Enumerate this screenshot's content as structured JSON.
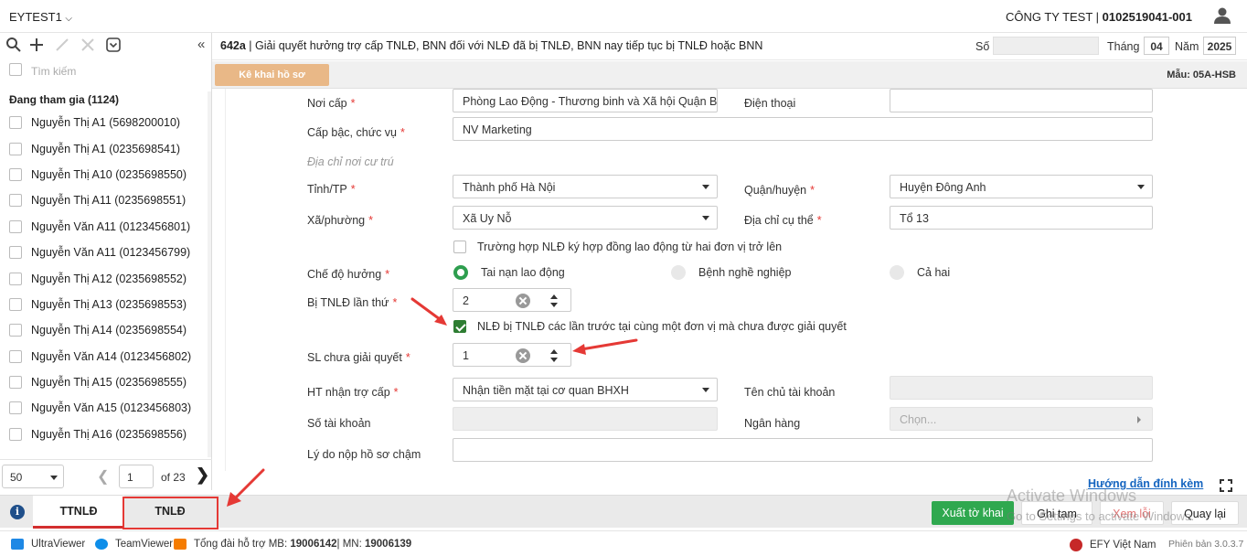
{
  "app": {
    "title": "EYTEST1",
    "company": "CÔNG TY TEST",
    "tax_code": "0102519041-001"
  },
  "sidebar": {
    "search_placeholder": "Tìm kiếm",
    "group_label": "Đang tham gia (1124)",
    "items": [
      "Nguyễn Thị A1 (5698200010)",
      "Nguyễn Thị A1 (0235698541)",
      "Nguyễn Thị A10 (0235698550)",
      "Nguyễn Thị A11 (0235698551)",
      "Nguyễn Văn A11 (0123456801)",
      "Nguyễn Văn A11 (0123456799)",
      "Nguyễn Thị A12 (0235698552)",
      "Nguyễn Thị A13 (0235698553)",
      "Nguyễn Thị A14 (0235698554)",
      "Nguyễn Văn A14 (0123456802)",
      "Nguyễn Thị A15 (0235698555)",
      "Nguyễn Văn A15 (0123456803)",
      "Nguyễn Thị A16 (0235698556)"
    ],
    "pager": {
      "page_size": "50",
      "page": "1",
      "of_label": "of",
      "total_pages": "23"
    }
  },
  "header": {
    "form_code": "642a",
    "form_title": " | Giải quyết hưởng trợ cấp TNLĐ, BNN đối với NLĐ đã bị TNLĐ, BNN nay tiếp tục bị TNLĐ hoặc BNN",
    "so_label": "Số",
    "thang_label": "Tháng",
    "thang_value": "04",
    "nam_label": "Năm",
    "nam_value": "2025"
  },
  "subbar": {
    "ke_khai": "Kê khai hồ sơ",
    "mau": "Mẫu: 05A-HSB"
  },
  "form": {
    "noi_cap_label": "Nơi cấp",
    "noi_cap_value": "Phòng Lao Động - Thương binh và Xã hội Quận Ba Đình",
    "dien_thoai_label": "Điện thoại",
    "cap_bac_label": "Cấp bậc, chức vụ",
    "cap_bac_value": "NV Marketing",
    "dia_chi_section": "Địa chỉ nơi cư trú",
    "tinh_label": "Tỉnh/TP",
    "tinh_value": "Thành phố Hà Nội",
    "quan_label": "Quận/huyện",
    "quan_value": "Huyện Đông Anh",
    "xa_label": "Xã/phường",
    "xa_value": "Xã Uy Nỗ",
    "dia_chi_cu_the_label": "Địa chỉ cụ thể",
    "dia_chi_cu_the_value": "Tổ 13",
    "hai_don_vi_label": "Trường hợp NLĐ ký hợp đồng lao động từ hai đơn vị trở lên",
    "che_do_label": "Chế độ hưởng",
    "che_do_options": [
      "Tai nạn lao động",
      "Bệnh nghề nghiệp",
      "Cả hai"
    ],
    "bi_tnld_label": "Bị TNLĐ lần thứ",
    "bi_tnld_value": "2",
    "cung_don_vi_label": "NLĐ bị TNLĐ các lần trước tại cùng một đơn vị mà chưa được giải quyết",
    "sl_chua_label": "SL chưa giải quyết",
    "sl_chua_value": "1",
    "ht_nhan_label": "HT nhận trợ cấp",
    "ht_nhan_value": "Nhận tiền mặt tại cơ quan BHXH",
    "ten_chu_tk_label": "Tên chủ tài khoản",
    "so_tk_label": "Số tài khoản",
    "ngan_hang_label": "Ngân hàng",
    "ngan_hang_placeholder": "Chọn...",
    "ly_do_label": "Lý do nộp hồ sơ chậm",
    "huong_dan": "Hướng dẫn đính kèm"
  },
  "tabs": [
    "TTNLĐ",
    "TNLĐ"
  ],
  "buttons": {
    "xuat": "Xuất tờ khai",
    "ghi_tam": "Ghi tạm",
    "xem_loi": "Xem lỗi",
    "quay_lai": "Quay lại"
  },
  "watermark": {
    "line1": "Activate Windows",
    "line2": "Go to Settings to activate Windows."
  },
  "footer": {
    "ultraviewer": "UltraViewer",
    "teamviewer": "TeamViewer",
    "hotline_prefix": "Tổng đài hỗ trợ MB:",
    "hotline_mb": "19006142",
    "hotline_sep": " | MN:",
    "hotline_mn": "19006139",
    "efy": "EFY Việt Nam",
    "version": "Phiên bản 3.0.3.7"
  },
  "colors": {
    "accent_green": "#2fa84f",
    "ke_khai_bg": "#e9b887",
    "annotation_red": "#e53935",
    "link_blue": "#1565c0"
  }
}
